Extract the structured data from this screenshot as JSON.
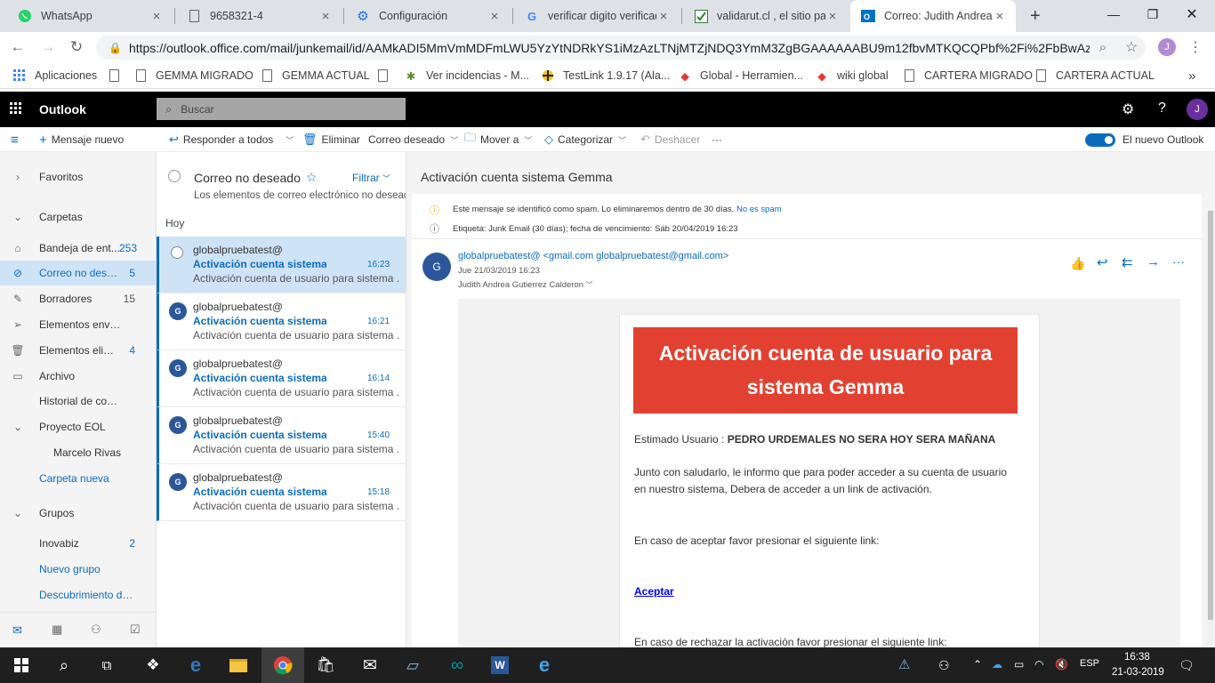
{
  "browser": {
    "tabs": [
      {
        "title": "WhatsApp",
        "icon": "whatsapp-icon"
      },
      {
        "title": "9658321-4",
        "icon": "document-icon"
      },
      {
        "title": "Configuración",
        "icon": "gear-icon"
      },
      {
        "title": "verificar digito verificad",
        "icon": "google-icon"
      },
      {
        "title": "validarut.cl , el sitio pa",
        "icon": "checkmark-icon"
      },
      {
        "title": "Correo: Judith Andrea G",
        "icon": "outlook-icon"
      }
    ],
    "new_tab": "+",
    "url": "https://outlook.office.com/mail/junkemail/id/AAMkADI5MmVmMDFmLWU5YzYtNDRkYS1iMzAzLTNjMTZjNDQ3YmM3ZgBGAAAAAABU9m12fbvMTKQCQPbf%2Fi%2FbBwAz...",
    "profile_initial": "J",
    "bookmarks": [
      "Aplicaciones",
      "GEMMA MIGRADO",
      "GEMMA ACTUAL",
      "Ver incidencias - M...",
      "TestLink 1.9.17 (Ala...",
      "Global - Herramien...",
      "wiki global",
      "CARTERA MIGRADO",
      "CARTERA ACTUAL"
    ],
    "more": "»"
  },
  "outlook": {
    "app_name": "Outlook",
    "search_placeholder": "Buscar",
    "help": "?",
    "user_initial": "J",
    "toolbar": {
      "new_message": "Mensaje nuevo",
      "reply_all": "Responder a todos",
      "delete": "Eliminar",
      "junk": "Correo deseado",
      "move": "Mover a",
      "categorize": "Categorizar",
      "undo": "Deshacer",
      "more": "···",
      "new_outlook": "El nuevo Outlook"
    },
    "nav": {
      "favorites": "Favoritos",
      "folders": "Carpetas",
      "items": [
        {
          "label": "Bandeja de ent...",
          "count": "253",
          "icon": "inbox-icon"
        },
        {
          "label": "Correo no desea...",
          "count": "5",
          "icon": "blocked-icon"
        },
        {
          "label": "Borradores",
          "count": "15",
          "icon": "pencil-icon"
        },
        {
          "label": "Elementos enviados",
          "count": "",
          "icon": "send-icon"
        },
        {
          "label": "Elementos elimin...",
          "count": "4",
          "icon": "trash-icon"
        },
        {
          "label": "Archivo",
          "count": "",
          "icon": "archive-icon"
        },
        {
          "label": "Historial de conver...",
          "count": ""
        },
        {
          "label": "Proyecto EOL",
          "count": ""
        },
        {
          "label": "Marcelo Rivas",
          "count": ""
        }
      ],
      "new_folder": "Carpeta nueva",
      "groups": "Grupos",
      "group_items": [
        {
          "label": "Inovabiz",
          "count": "2"
        }
      ],
      "new_group": "Nuevo grupo",
      "discover": "Descubrimiento de ..."
    },
    "list": {
      "title": "Correo no deseado",
      "filter": "Filtrar",
      "notice": "Los elementos de correo electrónico no deseado",
      "section": "Hoy",
      "messages": [
        {
          "from": "globalpruebatest@",
          "subject": "Activación cuenta sistema...",
          "time": "16:23",
          "preview": "Activación cuenta de usuario para sistema ...",
          "initial": "G"
        },
        {
          "from": "globalpruebatest@",
          "subject": "Activación cuenta sistema...",
          "time": "16:21",
          "preview": "Activación cuenta de usuario para sistema ...",
          "initial": "G"
        },
        {
          "from": "globalpruebatest@",
          "subject": "Activación cuenta sistema...",
          "time": "16:14",
          "preview": "Activación cuenta de usuario para sistema ...",
          "initial": "G"
        },
        {
          "from": "globalpruebatest@",
          "subject": "Activación cuenta sistema...",
          "time": "15:40",
          "preview": "Activación cuenta de usuario para sistema ...",
          "initial": "G"
        },
        {
          "from": "globalpruebatest@",
          "subject": "Activación cuenta sistema...",
          "time": "15:18",
          "preview": "Activación cuenta de usuario para sistema ...",
          "initial": "G"
        }
      ]
    },
    "reading": {
      "subject": "Activación cuenta sistema Gemma",
      "spam_notice": "Este mensaje se identificó como spam. Lo eliminaremos dentro de 30 días.",
      "not_spam": "No es spam",
      "label_notice": "Etiqueta: Junk Email (30 días); fecha de vencimiento: Sáb 20/04/2019 16:23",
      "sender_initial": "G",
      "sender": "globalpruebatest@ <gmail.com globalpruebatest@gmail.com>",
      "date": "Jue 21/03/2019 16:23",
      "recipient": "Judith Andrea Gutierrez Calderon",
      "body": {
        "banner": "Activación cuenta de usuario para sistema Gemma",
        "greeting": "Estimado Usuario : ",
        "user_name": "PEDRO URDEMALES NO SERA HOY SERA MAÑANA",
        "para1": "Junto con saludarlo, le informo que para poder acceder a su cuenta de usuario en nuestro sistema, Debera de acceder a un link de activación.",
        "para2": "En caso de aceptar favor presionar el siguiente link:",
        "accept_link": "Aceptar",
        "para3": "En caso de rechazar la activación favor presionar el siguiente link:"
      }
    }
  },
  "taskbar": {
    "lang": "ESP",
    "time": "16:38",
    "date": "21-03-2019"
  },
  "colors": {
    "accent": "#0b6cbd",
    "banner": "#e24131",
    "selected": "#cfe3f6"
  }
}
